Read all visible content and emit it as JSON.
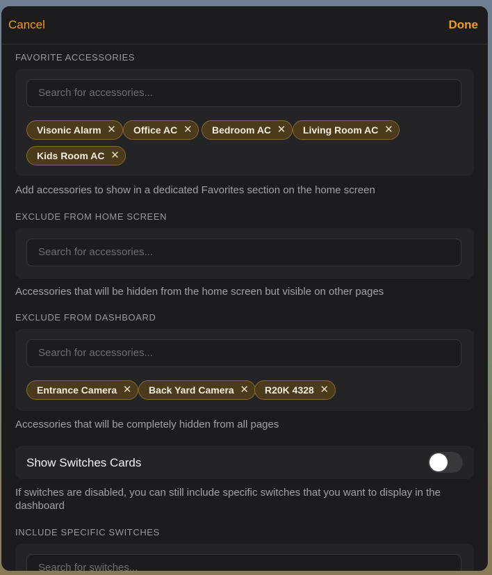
{
  "nav": {
    "cancel_label": "Cancel",
    "done_label": "Done"
  },
  "favorites": {
    "title": "FAVORITE ACCESSORIES",
    "search_placeholder": "Search for accessories...",
    "chips": [
      "Visonic Alarm",
      "Office AC",
      "Bedroom AC",
      "Living Room AC",
      "Kids Room AC"
    ],
    "hint": "Add accessories to show in a dedicated Favorites section on the home screen"
  },
  "exclude_home": {
    "title": "EXCLUDE FROM HOME SCREEN",
    "search_placeholder": "Search for accessories...",
    "hint": "Accessories that will be hidden from the home screen but visible on other pages"
  },
  "exclude_dashboard": {
    "title": "EXCLUDE FROM DASHBOARD",
    "search_placeholder": "Search for accessories...",
    "chips": [
      "Entrance Camera",
      "Back Yard Camera",
      "R20K 4328"
    ],
    "hint": "Accessories that will be completely hidden from all pages"
  },
  "switches": {
    "label": "Show Switches Cards",
    "enabled": false,
    "hint": "If switches are disabled, you can still include specific switches that you want to display in the dashboard"
  },
  "include_switches": {
    "title": "INCLUDE SPECIFIC SWITCHES",
    "search_placeholder": "Search for switches..."
  },
  "icons": {
    "chip_remove": "close-icon"
  },
  "colors": {
    "accent": "#f39a1f",
    "chip_bg": "#4b3a1c",
    "chip_border": "#8a6a2c"
  }
}
